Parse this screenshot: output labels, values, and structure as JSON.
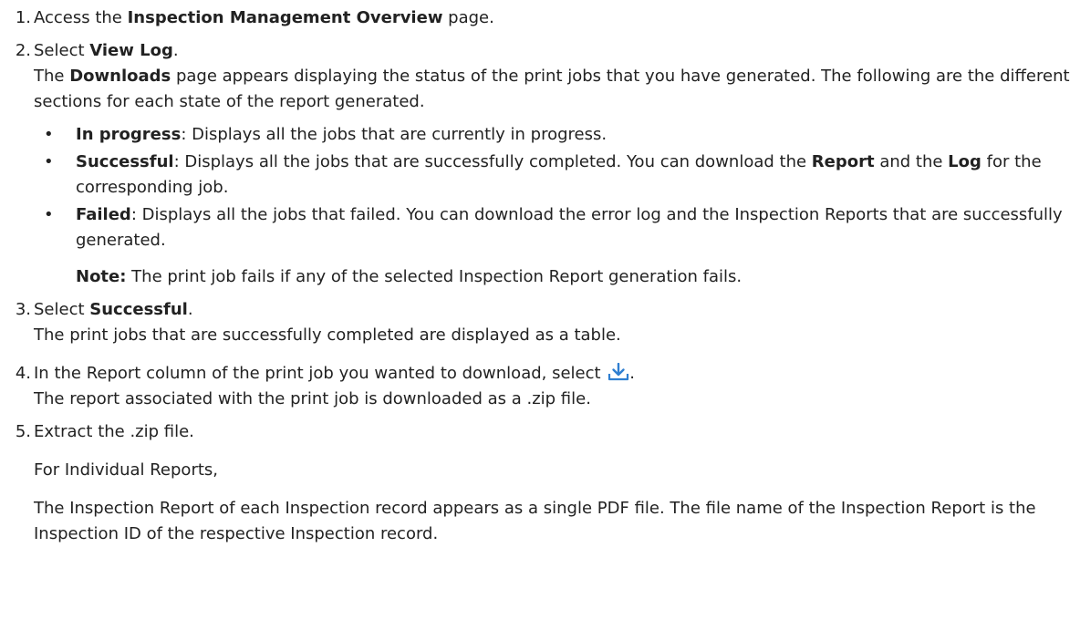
{
  "steps": [
    {
      "num": "1.",
      "pre": "Access the ",
      "bold": "Inspection Management Overview",
      "post": " page."
    },
    {
      "num": "2.",
      "pre": "Select ",
      "bold": "View Log",
      "post": ".",
      "result_parts": [
        "The ",
        "Downloads",
        " page appears displaying the status of the print jobs that you have generated. The following are the different sections for each state of the report generated."
      ],
      "bullets": [
        {
          "term": "In progress",
          "text": ": Displays all the jobs that are currently in progress."
        },
        {
          "term": "Successful",
          "text": ": Displays all the jobs that are successfully completed. You can download the ",
          "term2": "Report",
          "text2": " and the ",
          "term3": "Log",
          "text3": " for the corresponding job."
        },
        {
          "term": "Failed",
          "text": ": Displays all the jobs that failed. You can download the error log and the Inspection Reports that are successfully generated."
        }
      ],
      "note_label": "Note:",
      "note_text": " The print job fails if any of the selected Inspection Report generation fails."
    },
    {
      "num": "3.",
      "pre": "Select ",
      "bold": "Successful",
      "post": ".",
      "result": "The print jobs that are successfully completed are displayed as a table."
    },
    {
      "num": "4.",
      "line": "In the Report column of the print job you wanted to download, select ",
      "line_end": ".",
      "icon": "download-icon",
      "result": "The report associated with the print job is downloaded as a .zip file."
    },
    {
      "num": "5.",
      "line": "Extract the .zip file.",
      "para1": "For Individual Reports,",
      "para2": "The Inspection Report of each Inspection record appears as a single PDF file. The file name of the Inspection Report is the Inspection ID of the respective Inspection record."
    }
  ],
  "colors": {
    "text": "#222222",
    "icon": "#2f7fd1"
  }
}
